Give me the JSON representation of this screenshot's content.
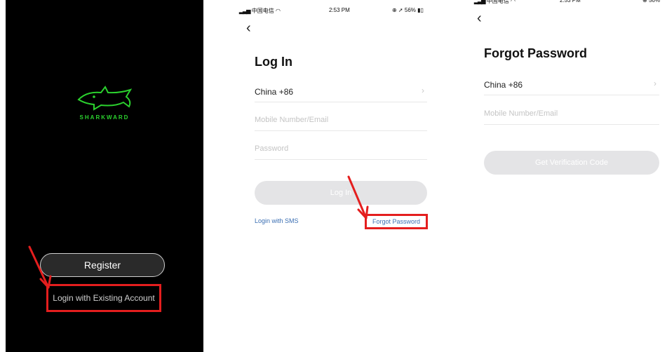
{
  "splash": {
    "brand": "SHARKWARD",
    "register_label": "Register",
    "existing_label": "Login with Existing Account"
  },
  "status_bar": {
    "carrier": "中国电信",
    "time": "2:53 PM",
    "battery": "56%"
  },
  "login": {
    "title": "Log In",
    "country": "China +86",
    "account_placeholder": "Mobile Number/Email",
    "password_placeholder": "Password",
    "login_button": "Log In",
    "sms_link": "Login with SMS",
    "forgot_link": "Forgot Password"
  },
  "forgot": {
    "title": "Forgot Password",
    "country": "China +86",
    "account_placeholder": "Mobile Number/Email",
    "code_button": "Get Verification Code"
  },
  "colors": {
    "highlight": "#e41e1e",
    "brand_green": "#2bd12e",
    "link_blue": "#3b6fb3"
  }
}
